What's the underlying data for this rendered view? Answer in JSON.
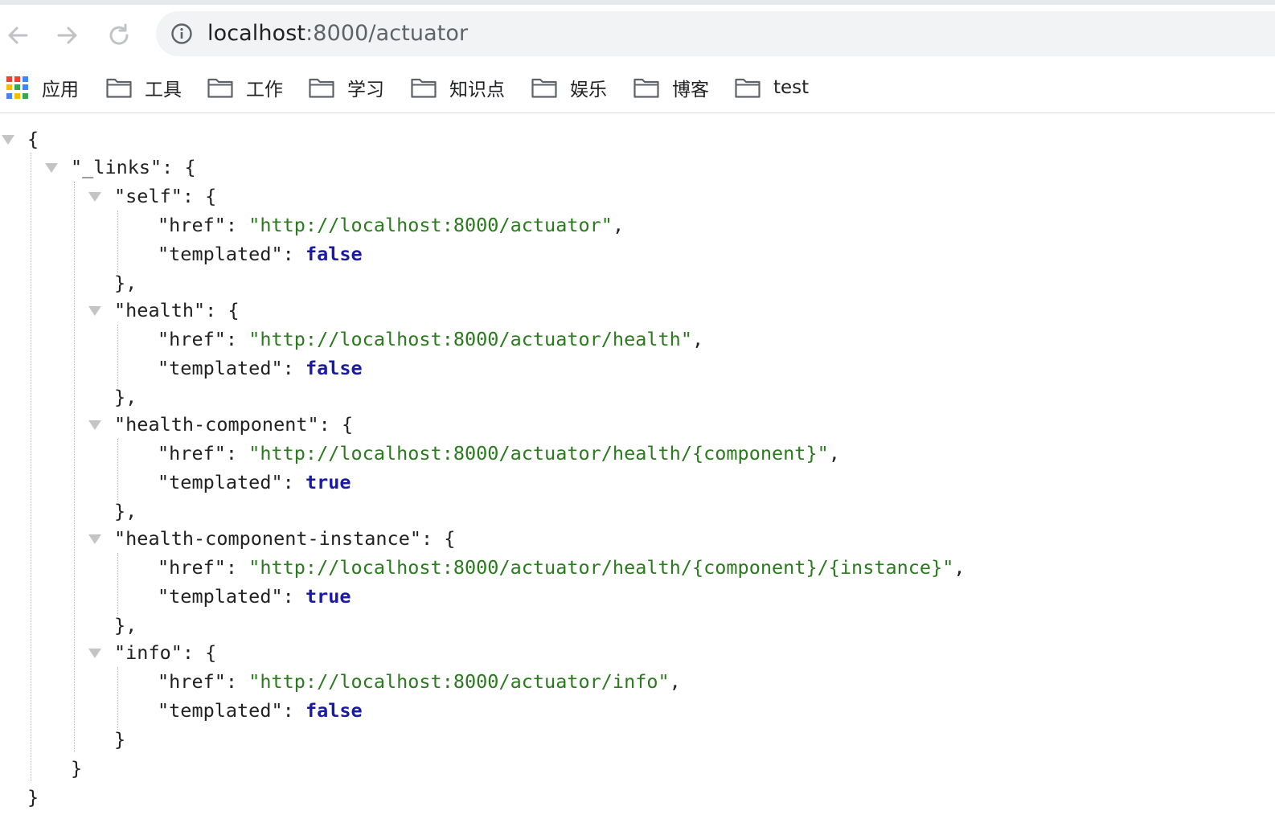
{
  "browser": {
    "url_host": "localhost",
    "url_path": ":8000/actuator",
    "bookmarks": [
      {
        "label": "应用",
        "icon": "apps-grid-icon"
      },
      {
        "label": "工具",
        "icon": "folder-icon"
      },
      {
        "label": "工作",
        "icon": "folder-icon"
      },
      {
        "label": "学习",
        "icon": "folder-icon"
      },
      {
        "label": "知识点",
        "icon": "folder-icon"
      },
      {
        "label": "娱乐",
        "icon": "folder-icon"
      },
      {
        "label": "博客",
        "icon": "folder-icon"
      },
      {
        "label": "test",
        "icon": "folder-icon"
      }
    ]
  },
  "json_view": {
    "open_brace": "{",
    "close_brace": "}",
    "links_key": "\"_links\": {",
    "links_close": "}",
    "href_key": "\"href\": ",
    "templated_key": "\"templated\": ",
    "entries": [
      {
        "key": "\"self\": {",
        "href": "\"http://localhost:8000/actuator\"",
        "templated": "false",
        "close": "},"
      },
      {
        "key": "\"health\": {",
        "href": "\"http://localhost:8000/actuator/health\"",
        "templated": "false",
        "close": "},"
      },
      {
        "key": "\"health-component\": {",
        "href": "\"http://localhost:8000/actuator/health/{component}\"",
        "templated": "true",
        "close": "},"
      },
      {
        "key": "\"health-component-instance\": {",
        "href": "\"http://localhost:8000/actuator/health/{component}/{instance}\"",
        "templated": "true",
        "close": "},"
      },
      {
        "key": "\"info\": {",
        "href": "\"http://localhost:8000/actuator/info\"",
        "templated": "false",
        "close": "}"
      }
    ]
  },
  "colors": {
    "string": "#2a7a1e",
    "boolean": "#1a1aa6",
    "key": "#222222"
  }
}
